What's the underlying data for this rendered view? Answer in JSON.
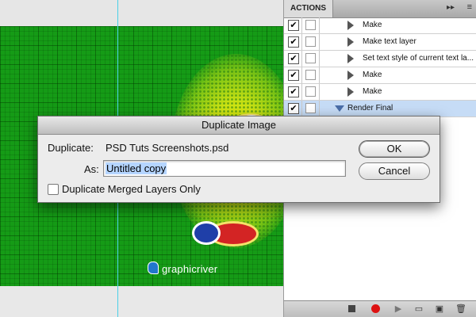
{
  "actions_panel": {
    "tab_label": "ACTIONS",
    "menu_glyph": "▸▸",
    "flyout_glyph": "≡",
    "rows": [
      {
        "label": "Make",
        "checked": true,
        "set": false
      },
      {
        "label": "Make text layer",
        "checked": true,
        "set": false
      },
      {
        "label": "Set text style of current text la...",
        "checked": true,
        "set": false
      },
      {
        "label": "Make",
        "checked": true,
        "set": false
      },
      {
        "label": "Make",
        "checked": true,
        "set": false
      },
      {
        "label": "Render Final",
        "checked": true,
        "set": true
      }
    ],
    "check_glyph": "✔"
  },
  "canvas": {
    "logo_text": "graphicriver"
  },
  "dialog": {
    "title": "Duplicate Image",
    "duplicate_label": "Duplicate:",
    "duplicate_value": "PSD Tuts Screenshots.psd",
    "as_label": "As:",
    "as_value": "Untitled copy",
    "merged_label": "Duplicate Merged Layers Only",
    "merged_checked": false,
    "ok_label": "OK",
    "cancel_label": "Cancel"
  },
  "colors": {
    "canvas_green": "#159b16",
    "selection_blue": "#c6dcf6",
    "record_red": "#dd1111"
  }
}
